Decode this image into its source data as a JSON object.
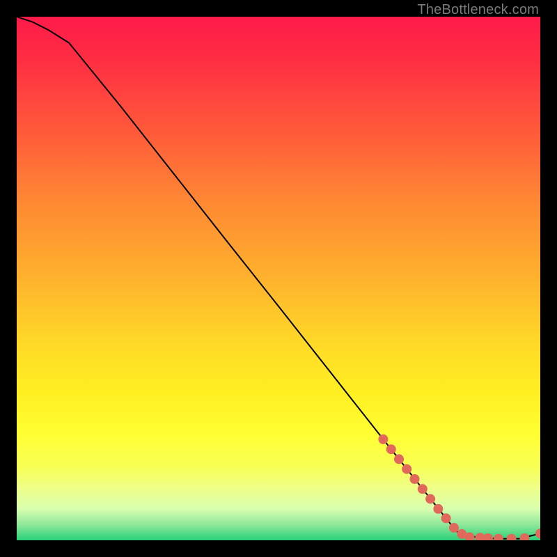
{
  "attribution": "TheBottleneck.com",
  "colors": {
    "gradient_top": "#ff1a4a",
    "gradient_mid": "#ffd827",
    "gradient_bottom": "#29d07a",
    "curve": "#000000",
    "marker": "#e0695b",
    "frame": "#000000"
  },
  "chart_data": {
    "type": "line",
    "title": "",
    "xlabel": "",
    "ylabel": "",
    "xlim": [
      0,
      100
    ],
    "ylim": [
      0,
      100
    ],
    "grid": false,
    "series": [
      {
        "name": "curve",
        "x": [
          0,
          3,
          6,
          10,
          20,
          30,
          40,
          50,
          60,
          70,
          75,
          80,
          84,
          88,
          92,
          96,
          100
        ],
        "y": [
          100,
          99,
          97.5,
          95,
          82.7,
          70,
          57.3,
          44.7,
          32,
          19.3,
          13,
          6.7,
          1.7,
          0.5,
          0.3,
          0.3,
          1.3
        ]
      }
    ],
    "markers": {
      "name": "highlight-points",
      "x": [
        70,
        71.5,
        73,
        74.5,
        76,
        77.5,
        79,
        80.5,
        82,
        83.5,
        85,
        86.5,
        88.5,
        90,
        92,
        94.5,
        97,
        100
      ],
      "y": [
        19.3,
        17.4,
        15.5,
        13.6,
        11.7,
        9.8,
        7.9,
        6.0,
        4.2,
        2.4,
        1.2,
        0.6,
        0.5,
        0.4,
        0.3,
        0.3,
        0.4,
        1.3
      ]
    }
  }
}
